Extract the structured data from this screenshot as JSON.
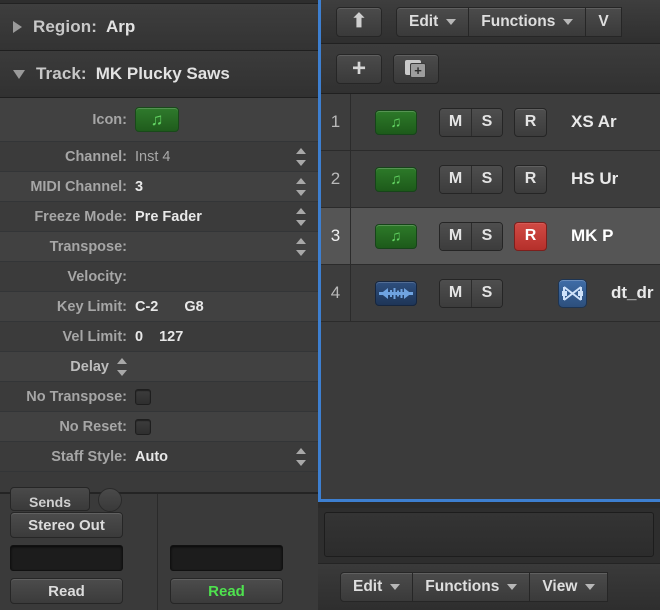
{
  "app": {
    "name": "Logic Pro Inspector",
    "accent_blue": "#3d7fd0",
    "record_red": "#c0392b",
    "inst_green": "#2d7a29",
    "audio_blue": "#2e4f7e"
  },
  "inspector": {
    "region_header": {
      "label": "Region:",
      "value": "Arp",
      "disclosure": "collapsed",
      "icon": "triangle-right-icon"
    },
    "track_header": {
      "label": "Track:",
      "value": "MK Plucky Saws",
      "disclosure": "expanded",
      "icon": "triangle-down-icon"
    },
    "parameters": [
      {
        "label": "Icon:",
        "value": "",
        "value2": "",
        "control": "icon-chip",
        "icon": "music-note-icon",
        "stepper": false
      },
      {
        "label": "Channel:",
        "value": "Inst 4",
        "value2": "",
        "control": "text-dim",
        "stepper": true
      },
      {
        "label": "MIDI Channel:",
        "value": "3",
        "value2": "",
        "control": "text",
        "stepper": true
      },
      {
        "label": "Freeze Mode:",
        "value": "Pre Fader",
        "value2": "",
        "control": "text",
        "stepper": true
      },
      {
        "label": "Transpose:",
        "value": "",
        "value2": "",
        "control": "text",
        "stepper": true
      },
      {
        "label": "Velocity:",
        "value": "",
        "value2": "",
        "control": "text",
        "stepper": false
      },
      {
        "label": "Key Limit:",
        "value": "C-2",
        "value2": "G8",
        "control": "pair",
        "stepper": false
      },
      {
        "label": "Vel Limit:",
        "value": "0",
        "value2": "127",
        "control": "pair",
        "stepper": false
      },
      {
        "label": "Delay",
        "value": "",
        "value2": "",
        "control": "delay",
        "stepper": true
      },
      {
        "label": "No Transpose:",
        "value": "",
        "value2": "",
        "control": "checkbox",
        "checked": false,
        "stepper": false
      },
      {
        "label": "No Reset:",
        "value": "",
        "value2": "",
        "control": "checkbox",
        "checked": false,
        "stepper": false
      },
      {
        "label": "Staff Style:",
        "value": "Auto",
        "value2": "",
        "control": "text",
        "stepper": true
      }
    ]
  },
  "mixer": {
    "strips": [
      {
        "cut_button": "Sends",
        "output_label": "Stereo Out",
        "field_value": "",
        "automation_mode": "Read",
        "automation_active": false
      },
      {
        "output_label": "",
        "field_value": "",
        "automation_mode": "Read",
        "automation_active": true
      }
    ]
  },
  "tracks_panel": {
    "toolbar": {
      "up_button_icon": "arrow-up-icon",
      "menus": [
        {
          "label": "Edit"
        },
        {
          "label": "Functions"
        },
        {
          "label": "V"
        }
      ]
    },
    "toolbar2": {
      "add_track_label": "+",
      "add_folder_icon": "new-folder-icon"
    },
    "rows": [
      {
        "number": "1",
        "icon": "instrument-icon",
        "icon_type": "inst",
        "mute": "M",
        "solo": "S",
        "record": "R",
        "record_armed": false,
        "has_record": true,
        "has_input": false,
        "name": "XS Ar"
      },
      {
        "number": "2",
        "icon": "instrument-icon",
        "icon_type": "inst",
        "mute": "M",
        "solo": "S",
        "record": "R",
        "record_armed": false,
        "has_record": true,
        "has_input": false,
        "name": "HS Ur"
      },
      {
        "number": "3",
        "icon": "instrument-icon",
        "icon_type": "inst",
        "mute": "M",
        "solo": "S",
        "record": "R",
        "record_armed": true,
        "has_record": true,
        "has_input": false,
        "name": "MK P",
        "selected": true
      },
      {
        "number": "4",
        "icon": "audio-icon",
        "icon_type": "audio",
        "mute": "M",
        "solo": "S",
        "record": "",
        "record_armed": false,
        "has_record": false,
        "has_input": true,
        "input_icon": "crossfade-icon",
        "name": "dt_dr"
      }
    ]
  },
  "bottom_bar": {
    "menus": [
      {
        "label": "Edit"
      },
      {
        "label": "Functions"
      },
      {
        "label": "View"
      }
    ]
  }
}
